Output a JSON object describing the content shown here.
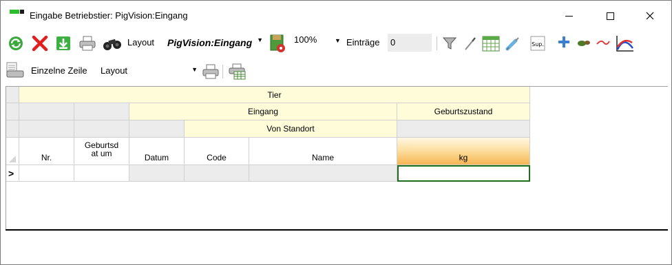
{
  "window": {
    "title": "Eingabe Betriebstier: PigVision:Eingang",
    "min_glyph": "—",
    "max_glyph": "☐",
    "close_glyph": "✕"
  },
  "toolbar1": {
    "layout_label": "Layout",
    "layout_value": "PigVision:Eingang",
    "zoom_value": "100%",
    "entries_label": "Einträge",
    "entries_value": "0",
    "sup_label": "Sup.",
    "icons": [
      "refresh-icon",
      "delete-icon",
      "save-down-icon",
      "print-icon",
      "binoculars-icon",
      "layout-settings-icon",
      "filter-icon",
      "wrench-icon",
      "calendar-icon",
      "syringe-icon",
      "sup-icon",
      "add-icon",
      "animal-icon",
      "weight-curve-icon",
      "chart-curve-icon"
    ]
  },
  "toolbar2": {
    "single_row_label": "Einzelne Zeile",
    "layout_value": "Layout",
    "icons": [
      "single-row-print-icon",
      "print-icon",
      "table-settings-icon"
    ]
  },
  "grid": {
    "group_row1": "Tier",
    "group_row2_eingang": "Eingang",
    "group_row2_geburtszustand": "Geburtszustand",
    "group_row3_von_standort": "Von Standort",
    "columns": [
      "Nr.",
      "Geburtsdat um",
      "Datum",
      "Code",
      "Name",
      "kg"
    ],
    "new_row_indicator": ">"
  },
  "colors": {
    "header_yellow": "#fffcd9",
    "header_grey": "#ececec",
    "selected_header_orange": "#f6b552",
    "selection_border": "#1d6d1d"
  }
}
